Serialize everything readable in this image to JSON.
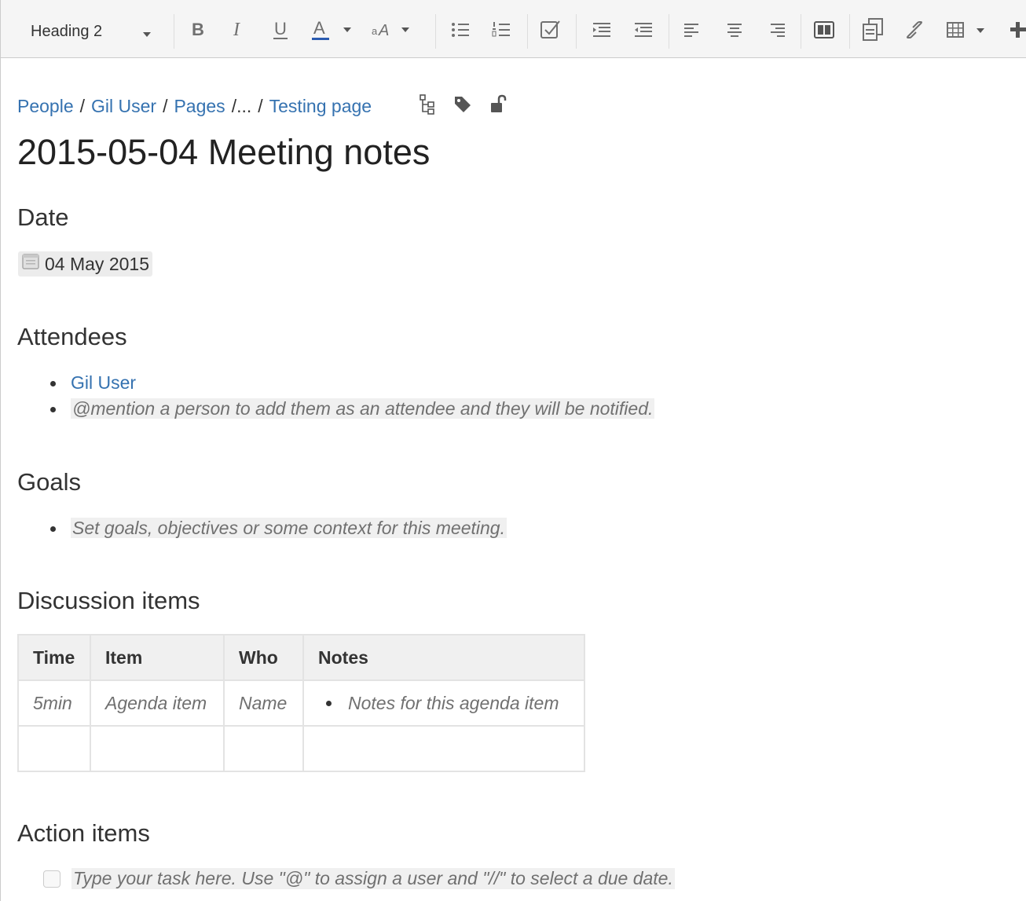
{
  "toolbar": {
    "format_select": "Heading 2",
    "buttons": [
      "bold",
      "italic",
      "underline",
      "text-color",
      "more-formatting",
      "bullet-list",
      "numbered-list",
      "task-list",
      "outdent",
      "indent",
      "align-left",
      "align-center",
      "align-right",
      "page-layout",
      "insert-files",
      "link",
      "table",
      "insert-more"
    ]
  },
  "breadcrumb": {
    "items": [
      "People",
      "Gil User",
      "Pages",
      "...",
      "Testing page"
    ],
    "separator": "/"
  },
  "page_title": "2015-05-04 Meeting notes",
  "sections": {
    "date_heading": "Date",
    "date_value": "04 May 2015",
    "attendees_heading": "Attendees",
    "attendees": [
      "Gil User",
      "@mention a person to add them as an attendee and they will be notified."
    ],
    "goals_heading": "Goals",
    "goals": [
      "Set goals, objectives or some context for this meeting."
    ],
    "discussion_heading": "Discussion items",
    "discussion_table": {
      "headers": [
        "Time",
        "Item",
        "Who",
        "Notes"
      ],
      "rows": [
        [
          "5min",
          "Agenda item",
          "Name",
          "Notes for this agenda item"
        ],
        [
          "",
          "",
          "",
          ""
        ]
      ]
    },
    "action_heading": "Action items",
    "action_placeholder": "Type your task here. Use \"@\" to assign a user and \"//\" to select a due date."
  },
  "colors": {
    "link": "#3572b0",
    "placeholder_text": "#707070",
    "toolbar_bg": "#f5f5f5"
  }
}
